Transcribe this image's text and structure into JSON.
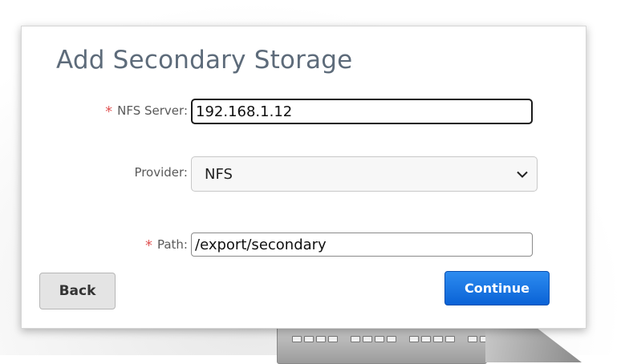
{
  "dialog": {
    "title": "Add Secondary Storage"
  },
  "form": {
    "required_marker": "*",
    "nfs_server": {
      "label": "NFS Server:",
      "value": "192.168.1.12",
      "required": true
    },
    "provider": {
      "label": "Provider:",
      "selected": "NFS"
    },
    "path": {
      "label": "Path:",
      "value": "/export/secondary",
      "required": true
    }
  },
  "buttons": {
    "back_label": "Back",
    "continue_label": "Continue"
  },
  "icons": {
    "provider_dropdown": "chevron-down-icon"
  },
  "colors": {
    "primary_button": "#0a62d6",
    "required_marker": "#e05555",
    "title": "#5d6b7a"
  }
}
